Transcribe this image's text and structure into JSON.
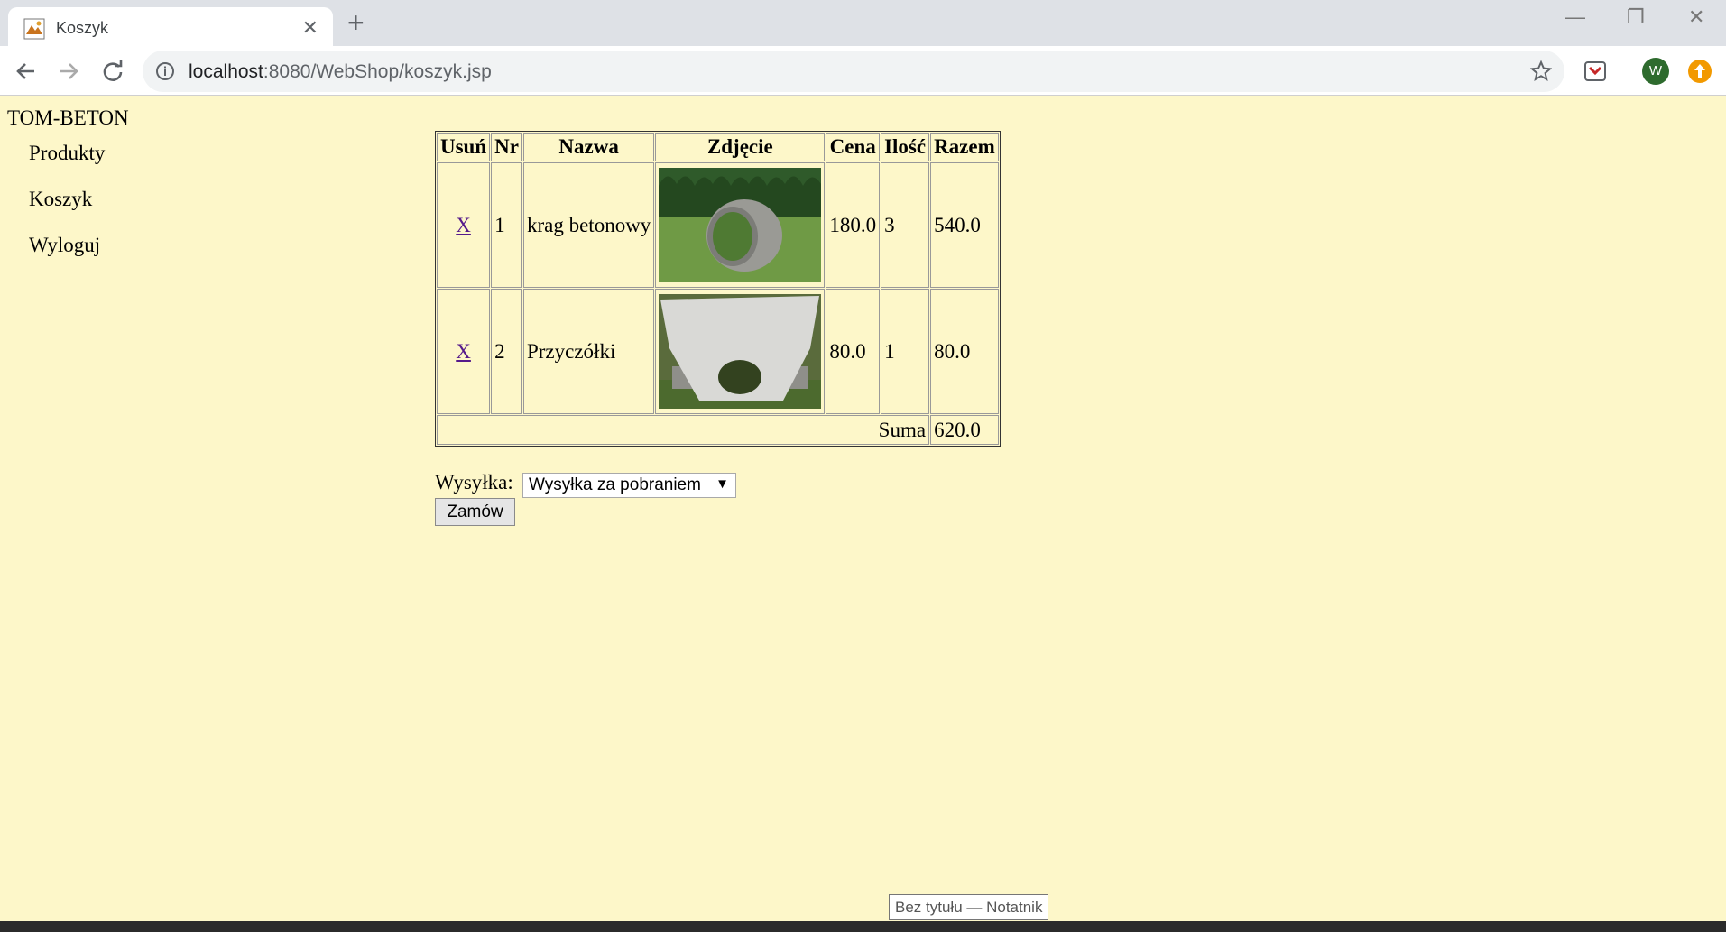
{
  "browser": {
    "tab_title": "Koszyk",
    "url_host": "localhost",
    "url_rest": ":8080/WebShop/koszyk.jsp",
    "profile_initial": "W"
  },
  "site": {
    "brand": "TOM-BETON",
    "menu": [
      "Produkty",
      "Koszyk",
      "Wyloguj"
    ]
  },
  "cart": {
    "headers": [
      "Usuń",
      "Nr",
      "Nazwa",
      "Zdjęcie",
      "Cena",
      "Ilość",
      "Razem"
    ],
    "rows": [
      {
        "remove": "X",
        "nr": "1",
        "name": "krag betonowy",
        "image": "concrete-ring-photo",
        "price": "180.0",
        "qty": "3",
        "total": "540.0"
      },
      {
        "remove": "X",
        "nr": "2",
        "name": "Przyczółki",
        "image": "concrete-abutment-photo",
        "price": "80.0",
        "qty": "1",
        "total": "80.0"
      }
    ],
    "sum_label": "Suma",
    "sum_value": "620.0"
  },
  "shipping": {
    "label": "Wysyłka:",
    "selected": "Wysyłka za pobraniem"
  },
  "order_button": "Zamów",
  "tooltip": "Bez tytułu — Notatnik",
  "colors": {
    "page_bg": "#fdf7c9",
    "link_visited": "#551a8b",
    "profile_green": "#2e6b2e",
    "update_orange": "#f29900"
  }
}
